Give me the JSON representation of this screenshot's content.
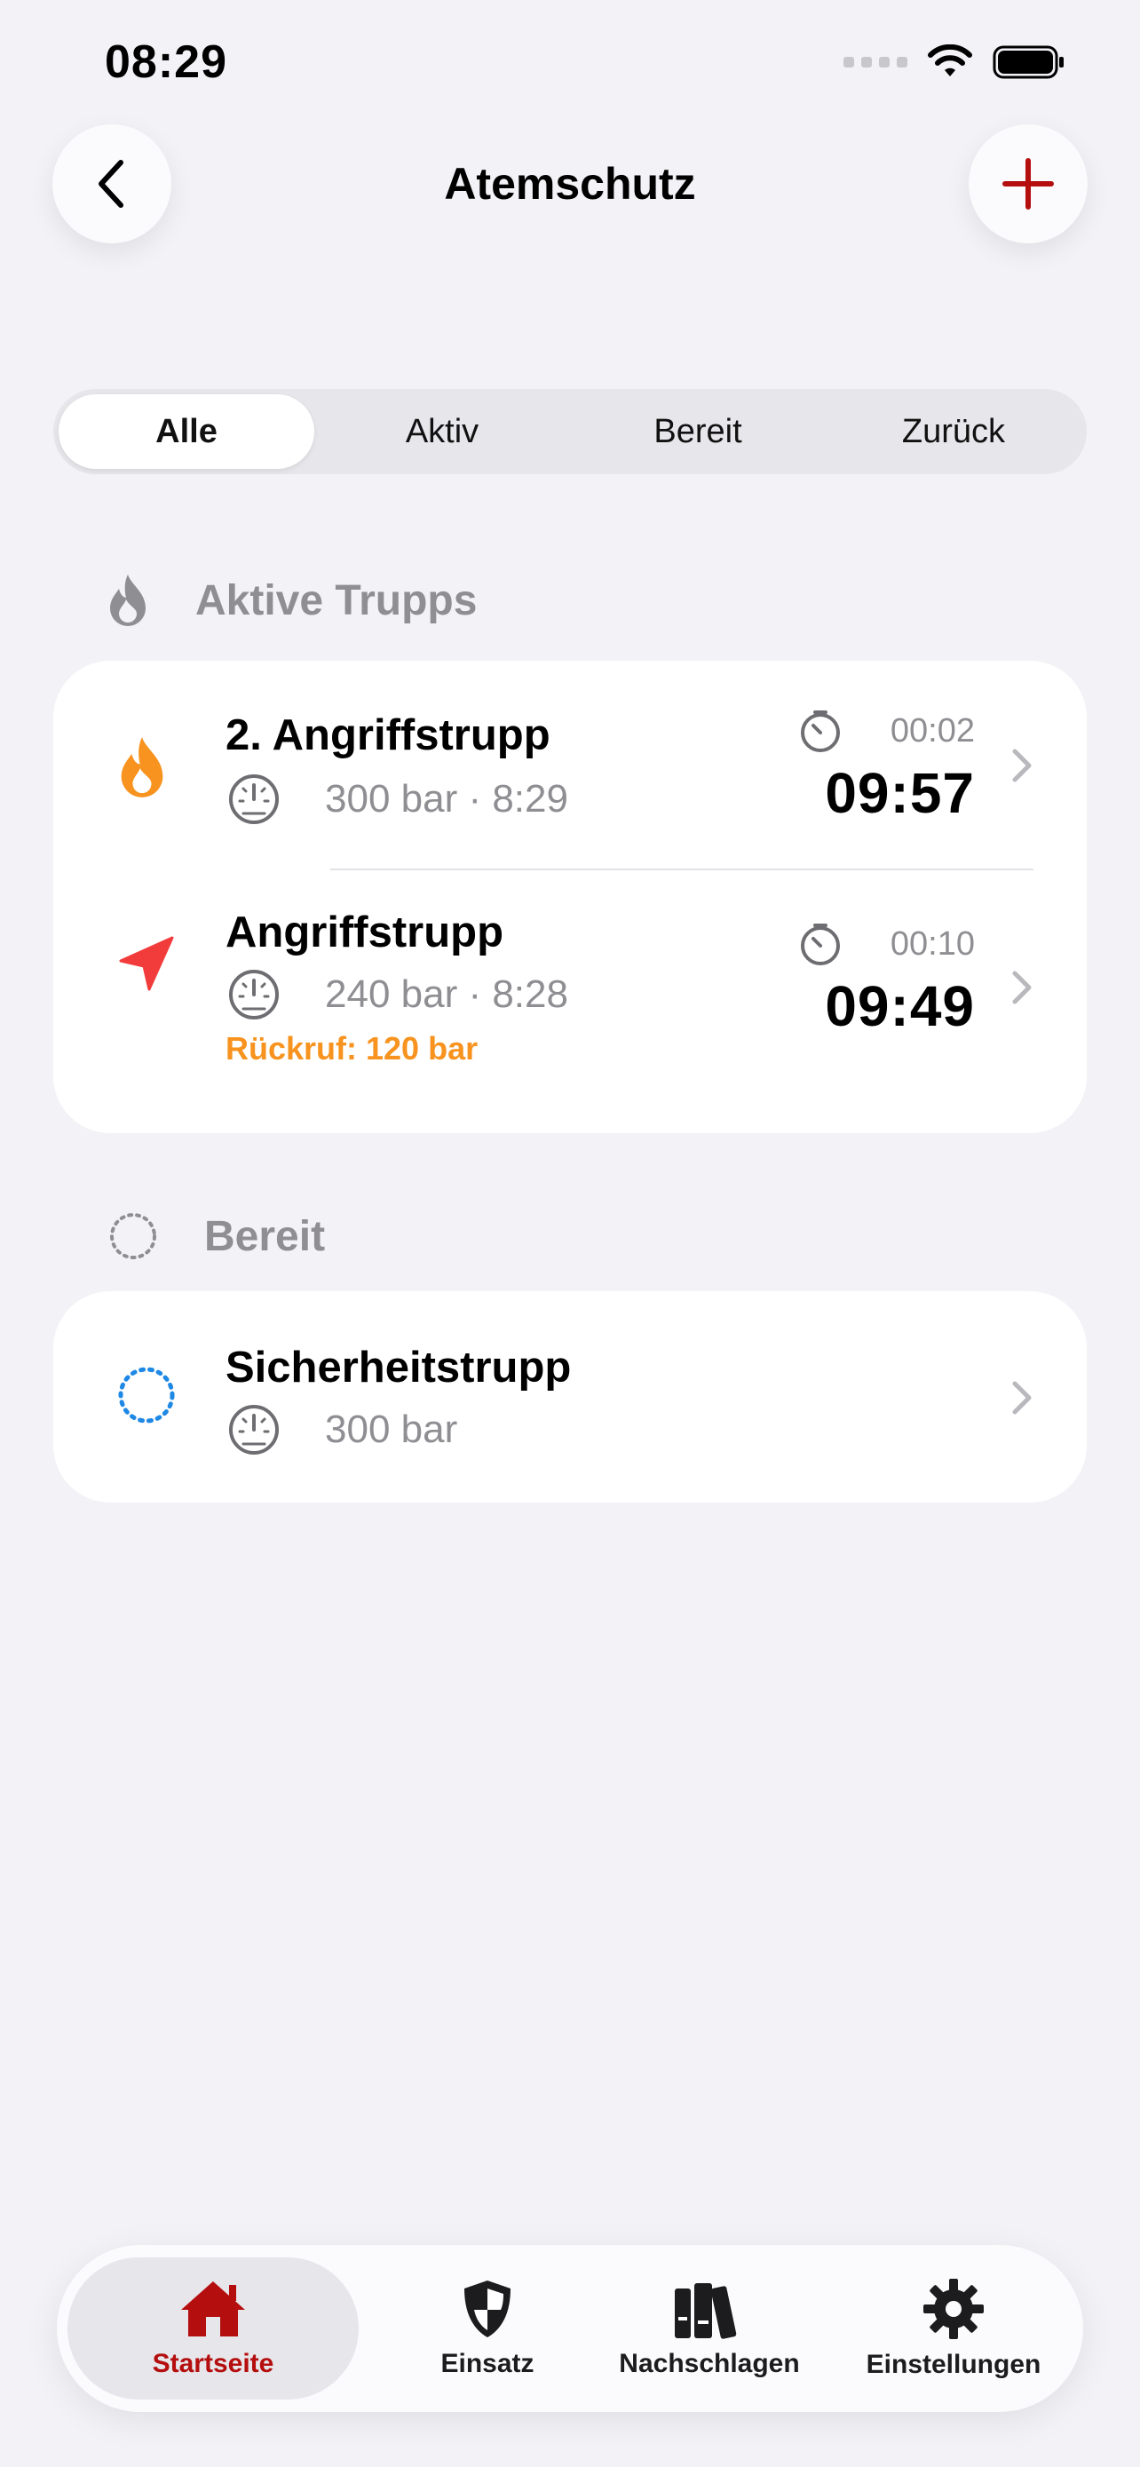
{
  "status_bar": {
    "time": "08:29"
  },
  "header": {
    "title": "Atemschutz"
  },
  "filter": {
    "segments": [
      {
        "label": "Alle",
        "active": true
      },
      {
        "label": "Aktiv",
        "active": false
      },
      {
        "label": "Bereit",
        "active": false
      },
      {
        "label": "Zurück",
        "active": false
      }
    ]
  },
  "sections": {
    "active": {
      "label": "Aktive Trupps",
      "icon": "flame-icon",
      "rows": [
        {
          "name": "2. Angriffstrupp",
          "pressure": "300 bar · 8:29",
          "elapsed": "00:02",
          "countdown": "09:57",
          "icon": "flame-icon",
          "icon_color": "#f7931e"
        },
        {
          "name": "Angriffstrupp",
          "pressure": "240 bar · 8:28",
          "recall": "Rückruf: 120 bar",
          "elapsed": "00:10",
          "countdown": "09:49",
          "icon": "location-arrow-icon",
          "icon_color": "#f23b3b"
        }
      ]
    },
    "ready": {
      "label": "Bereit",
      "icon": "dotted-circle-icon",
      "rows": [
        {
          "name": "Sicherheitstrupp",
          "pressure": "300 bar",
          "icon": "dotted-circle-icon",
          "icon_color": "#1e88e5"
        }
      ]
    }
  },
  "tabbar": {
    "tabs": [
      {
        "label": "Startseite",
        "icon": "home-icon",
        "active": true
      },
      {
        "label": "Einsatz",
        "icon": "shield-icon",
        "active": false
      },
      {
        "label": "Nachschlagen",
        "icon": "books-icon",
        "active": false
      },
      {
        "label": "Einstellungen",
        "icon": "gear-icon",
        "active": false
      }
    ]
  },
  "colors": {
    "accent": "#b50e0e",
    "warning": "#f7931e",
    "background": "#f2f2f7"
  }
}
